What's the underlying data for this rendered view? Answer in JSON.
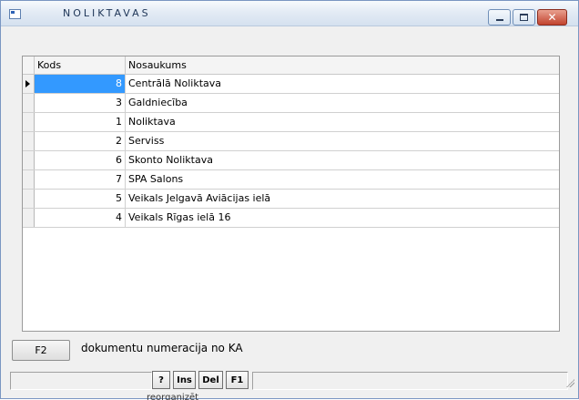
{
  "window": {
    "title": "NOLIKTAVAS"
  },
  "grid": {
    "columns": [
      "Kods",
      "Nosaukums"
    ],
    "rows": [
      {
        "kods": "8",
        "nosaukums": "Centrālā Noliktava",
        "selected": true
      },
      {
        "kods": "3",
        "nosaukums": "Galdniecība",
        "selected": false
      },
      {
        "kods": "1",
        "nosaukums": "Noliktava",
        "selected": false
      },
      {
        "kods": "2",
        "nosaukums": "Serviss",
        "selected": false
      },
      {
        "kods": "6",
        "nosaukums": "Skonto Noliktava",
        "selected": false
      },
      {
        "kods": "7",
        "nosaukums": "SPA Salons",
        "selected": false
      },
      {
        "kods": "5",
        "nosaukums": "Veikals Jelgavā Aviācijas ielā",
        "selected": false
      },
      {
        "kods": "4",
        "nosaukums": "Veikals Rīgas ielā 16",
        "selected": false
      }
    ],
    "selection_color": "#3399ff"
  },
  "actions": {
    "f2_label": "F2",
    "f2_description": "dokumentu numeracija no KA"
  },
  "statusbar": {
    "buttons": [
      "?",
      "Ins",
      "Del",
      "F1"
    ],
    "clipped_text": "reorganizēt indeksus"
  },
  "icons": [
    "app-window-icon",
    "minimize-icon",
    "maximize-icon",
    "close-icon",
    "row-pointer-icon",
    "resize-grip-icon"
  ],
  "colors": {
    "titlebar": "#dbe6f3",
    "close_button": "#c1432e",
    "background": "#f0f0f0"
  }
}
